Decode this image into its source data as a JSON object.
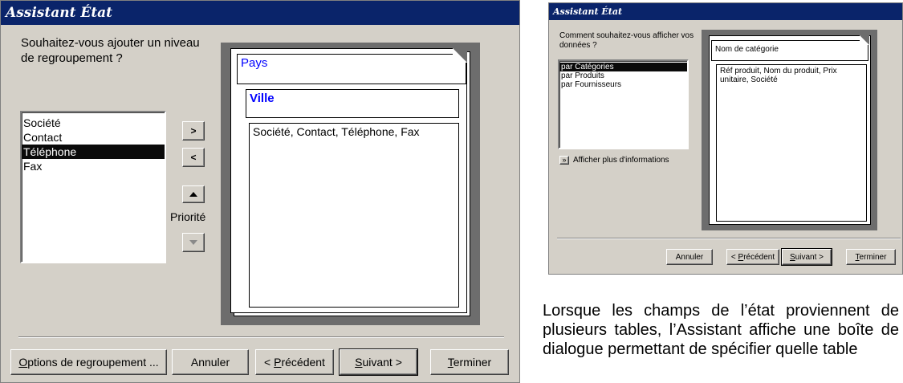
{
  "left_dialog": {
    "title": "Assistant État",
    "question": "Souhaitez-vous ajouter un niveau de regroupement ?",
    "fields": [
      {
        "label": "Société",
        "selected": false
      },
      {
        "label": "Contact",
        "selected": false
      },
      {
        "label": "Téléphone",
        "selected": true
      },
      {
        "label": "Fax",
        "selected": false
      }
    ],
    "add_button": ">",
    "remove_button": "<",
    "priority_label": "Priorité",
    "preview": {
      "level1": "Pays",
      "level2": "Ville",
      "detail": "Société, Contact, Téléphone, Fax"
    },
    "buttons": {
      "options": {
        "pre": "",
        "key": "O",
        "post": "ptions de regroupement ..."
      },
      "cancel": "Annuler",
      "previous": {
        "pre": "< ",
        "key": "P",
        "post": "récédent"
      },
      "next": {
        "pre": "",
        "key": "S",
        "post": "uivant >"
      },
      "finish": {
        "pre": "",
        "key": "T",
        "post": "erminer"
      }
    }
  },
  "right_dialog": {
    "title": "Assistant État",
    "question": "Comment souhaitez-vous afficher vos données ?",
    "options": [
      {
        "label": "par Catégories",
        "selected": true
      },
      {
        "label": "par Produits",
        "selected": false
      },
      {
        "label": "par Fournisseurs",
        "selected": false
      }
    ],
    "more_info_button": "»",
    "more_info_label": "Afficher plus d'informations",
    "preview": {
      "header": "Nom de catégorie",
      "detail": "Réf produit, Nom du produit, Prix unitaire, Société"
    },
    "buttons": {
      "cancel": "Annuler",
      "previous": {
        "pre": "< ",
        "key": "P",
        "post": "récédent"
      },
      "next": {
        "pre": "",
        "key": "S",
        "post": "uivant >"
      },
      "finish": {
        "pre": "",
        "key": "T",
        "post": "erminer"
      }
    }
  },
  "caption": "Lorsque les champs de l’état proviennent de plusieurs tables, l’Assistant affiche une boîte de dialogue permettant de spécifier quelle table"
}
